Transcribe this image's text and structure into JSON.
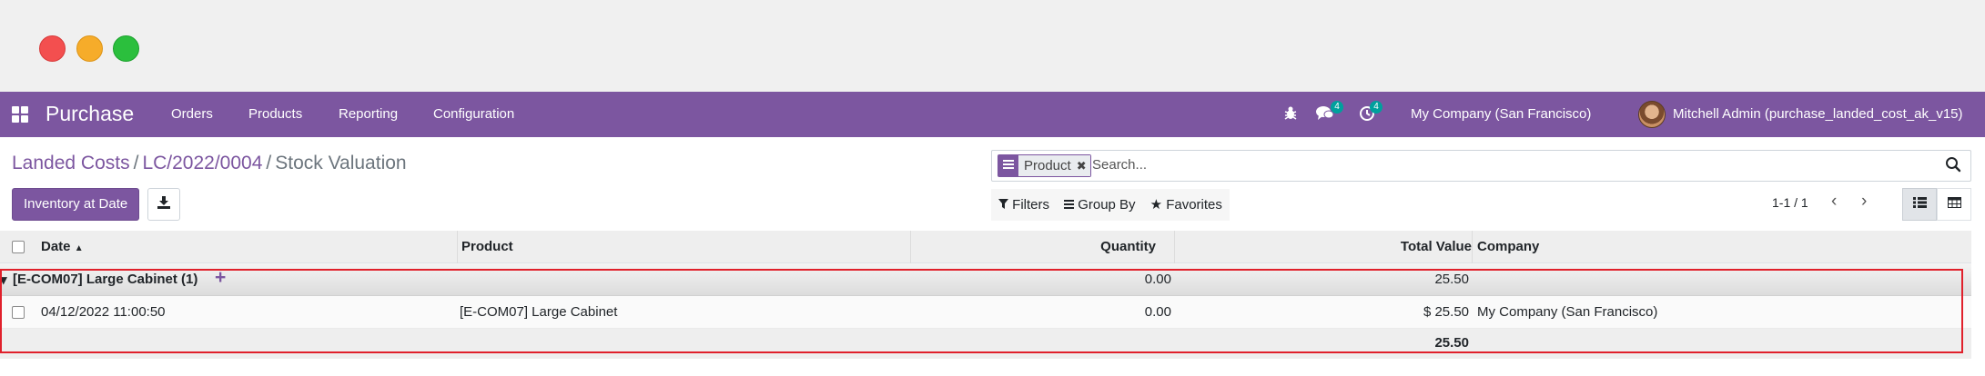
{
  "navbar": {
    "app_name": "Purchase",
    "menu": [
      "Orders",
      "Products",
      "Reporting",
      "Configuration"
    ],
    "messages_badge": "4",
    "activities_badge": "4",
    "company": "My Company (San Francisco)",
    "user": "Mitchell Admin (purchase_landed_cost_ak_v15)"
  },
  "breadcrumb": {
    "items": [
      "Landed Costs",
      "LC/2022/0004"
    ],
    "separator": "/",
    "active": "Stock Valuation"
  },
  "actions": {
    "inventory_at_date": "Inventory at Date"
  },
  "search": {
    "facet_value": "Product",
    "placeholder": "Search..."
  },
  "filters": {
    "filters_label": "Filters",
    "group_by_label": "Group By",
    "favorites_label": "Favorites"
  },
  "pager": {
    "value": "1-1 / 1"
  },
  "table": {
    "columns": [
      "Date",
      "Product",
      "Quantity",
      "Total Value",
      "Company"
    ],
    "group": {
      "label": "[E-COM07] Large Cabinet (1)",
      "quantity": "0.00",
      "total_value": "25.50"
    },
    "rows": [
      {
        "date": "04/12/2022 11:00:50",
        "product": "[E-COM07] Large Cabinet",
        "quantity": "0.00",
        "total_value": "$ 25.50",
        "company": "My Company (San Francisco)"
      }
    ],
    "footer_total": "25.50"
  },
  "colors": {
    "brand": "#7c56a0",
    "highlight_box": "#e0202b"
  }
}
